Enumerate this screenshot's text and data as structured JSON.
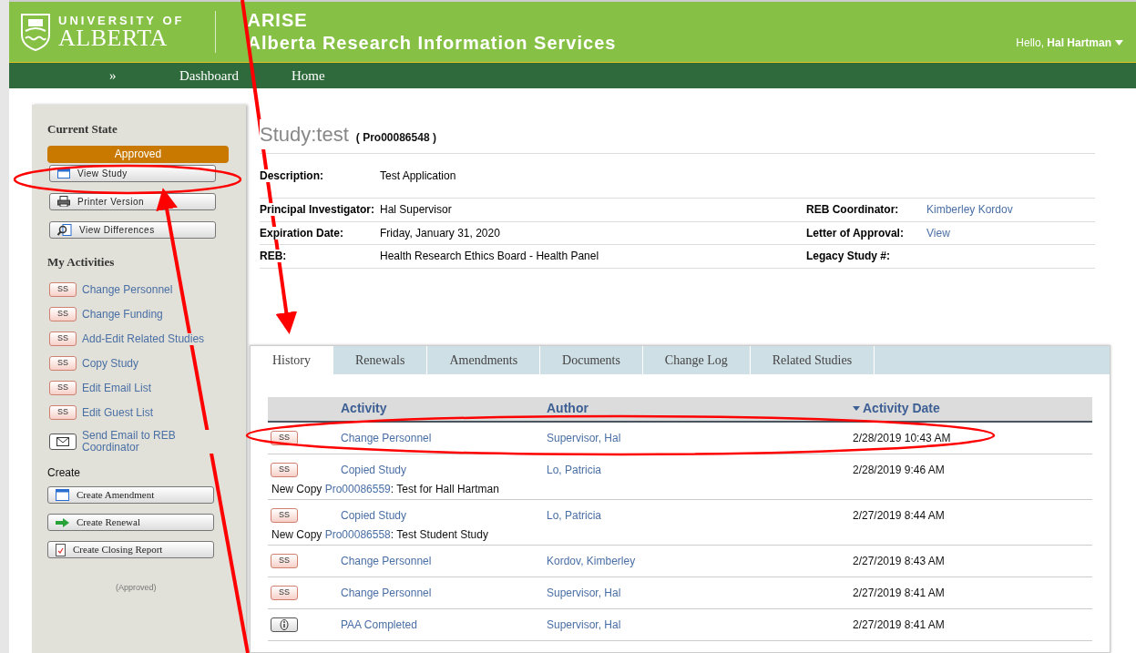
{
  "header": {
    "logo_top": "UNIVERSITY OF",
    "logo_bottom": "ALBERTA",
    "app_name": "ARISE",
    "app_subtitle": "Alberta Research Information Services",
    "greeting": "Hello, **Hal Hartman**"
  },
  "nav": [
    "»",
    "Dashboard",
    "Home"
  ],
  "sidebar": {
    "state_heading": "Current State",
    "state": "Approved",
    "state_buttons": [
      {
        "kind": "view",
        "label": "View Study"
      },
      {
        "kind": "printer",
        "label": "Printer Version"
      },
      {
        "kind": "diff",
        "label": "View Differences"
      }
    ],
    "activities_heading": "My Activities",
    "activities": [
      {
        "kind": "ss",
        "icon_text": "SS",
        "label": "Change Personnel"
      },
      {
        "kind": "ss",
        "icon_text": "SS",
        "label": "Change Funding"
      },
      {
        "kind": "ss",
        "icon_text": "SS",
        "label": "Add-Edit Related Studies"
      },
      {
        "kind": "ss",
        "icon_text": "SS",
        "label": "Copy Study"
      },
      {
        "kind": "ss",
        "icon_text": "SS",
        "label": "Edit Email List"
      },
      {
        "kind": "ss",
        "icon_text": "SS",
        "label": "Edit Guest List"
      },
      {
        "kind": "email",
        "label": "Send Email to REB Coordinator"
      }
    ],
    "create_heading": "Create",
    "create_buttons": [
      {
        "kind": "amendment",
        "label": "Create Amendment"
      },
      {
        "kind": "renewal",
        "label": "Create Renewal"
      },
      {
        "kind": "closing",
        "label": "Create Closing Report"
      }
    ],
    "footer": "(Approved)"
  },
  "study": {
    "title": "Study:test",
    "id": "( Pro00086548 )",
    "description_label": "Description:",
    "description": "Test Application",
    "details": [
      {
        "label": "Principal Investigator:",
        "value": "Hal Supervisor",
        "right_label": "REB Coordinator:",
        "right_value": "Kimberley Kordov"
      },
      {
        "label": "Expiration Date:",
        "value": "Friday, January 31, 2020",
        "right_label": "Letter of Approval:",
        "right_value": "View"
      },
      {
        "label": "REB:",
        "value": "Health Research Ethics Board - Health Panel",
        "right_label": "Legacy Study #:"
      }
    ]
  },
  "tabs": [
    {
      "label": "History",
      "selected": true
    },
    {
      "label": "Renewals",
      "selected": false
    },
    {
      "label": "Amendments",
      "selected": false
    },
    {
      "label": "Documents",
      "selected": false
    },
    {
      "label": "Change Log",
      "selected": false
    },
    {
      "label": "Related Studies",
      "selected": false
    }
  ],
  "table": {
    "columns": [
      {
        "label": "Activity",
        "sorted": false
      },
      {
        "label": "Author",
        "sorted": false
      },
      {
        "label": "Activity Date",
        "sorted": true
      }
    ],
    "rows": [
      {
        "kind": "ss",
        "icon_text": "SS",
        "activity": "Change Personnel",
        "author": "Supervisor, Hal",
        "date": "2/28/2019 10:43 AM"
      },
      {
        "kind": "ss",
        "icon_text": "SS",
        "activity": "Copied Study",
        "author": "Lo, Patricia",
        "date": "2/28/2019 9:46 AM",
        "note": {
          "prefix": "New Copy",
          "link": "Pro00086559",
          "suffix": ": Test for Hall Hartman"
        }
      },
      {
        "kind": "ss",
        "icon_text": "SS",
        "activity": "Copied Study",
        "author": "Lo, Patricia",
        "date": "2/27/2019 8:44 AM",
        "note": {
          "prefix": "New Copy",
          "link": "Pro00086558",
          "suffix": ": Test Student Study"
        }
      },
      {
        "kind": "ss",
        "icon_text": "SS",
        "activity": "Change Personnel",
        "author": "Kordov, Kimberley",
        "date": "2/27/2019 8:43 AM"
      },
      {
        "kind": "ss",
        "icon_text": "SS",
        "activity": "Change Personnel",
        "author": "Supervisor, Hal",
        "date": "2/27/2019 8:41 AM"
      },
      {
        "kind": "info",
        "activity": "PAA Completed",
        "author": "Supervisor, Hal",
        "date": "2/27/2019 8:41 AM"
      }
    ]
  }
}
